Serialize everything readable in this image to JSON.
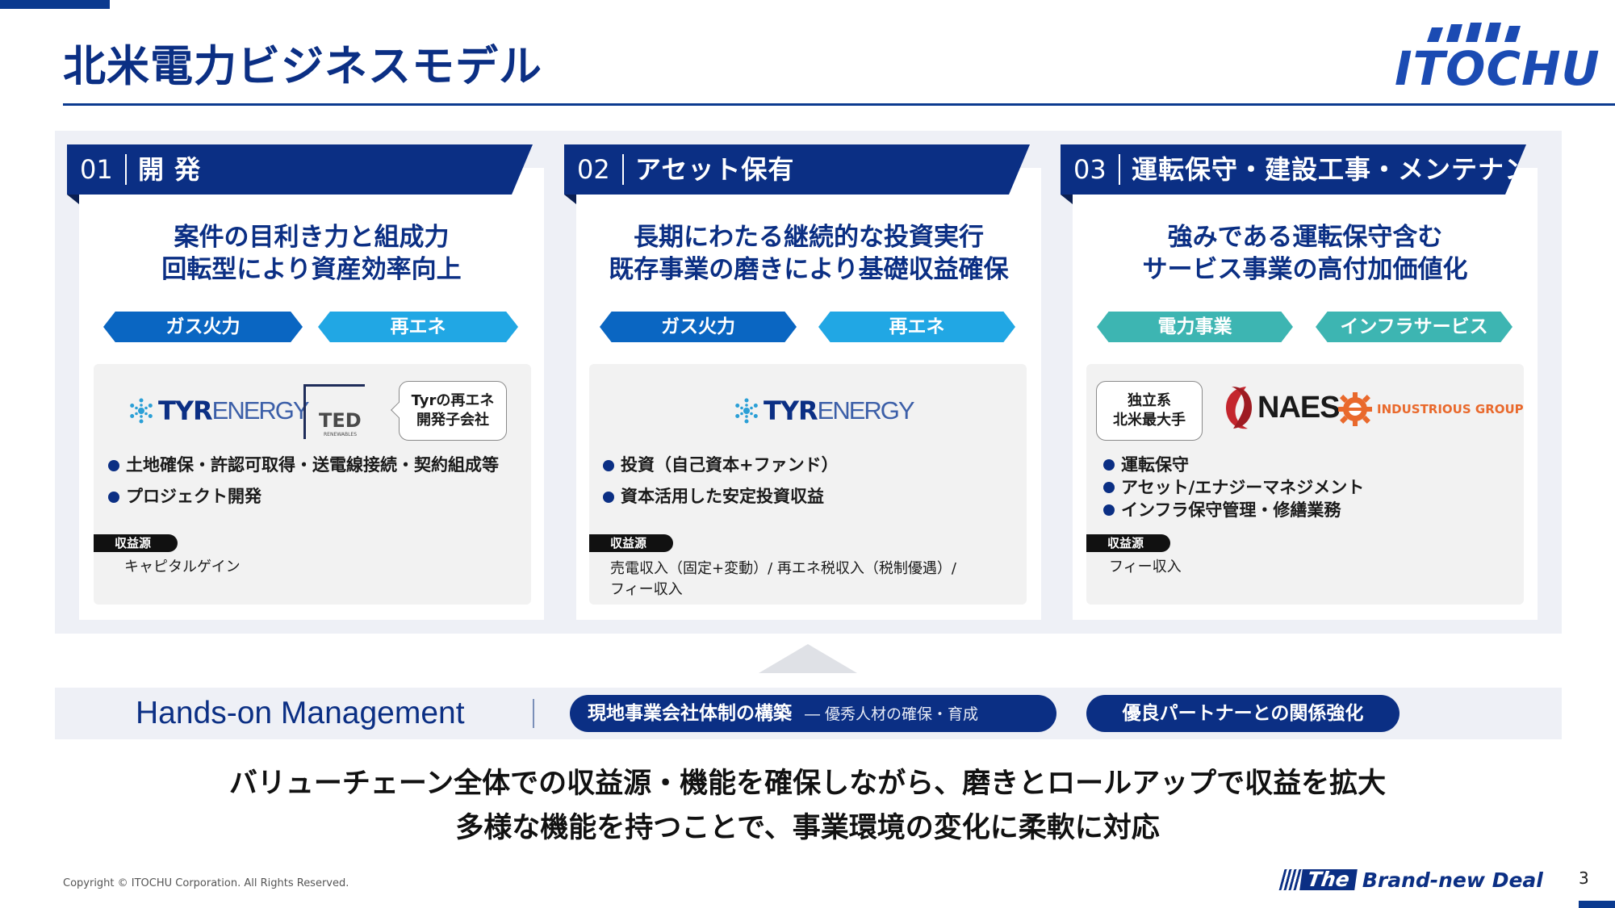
{
  "page_title": "北米電力ビジネスモデル",
  "logo": {
    "text": "ITOCHU"
  },
  "columns": [
    {
      "number": "01",
      "label": "開 発",
      "headline": [
        "案件の目利き力と組成力",
        "回転型により資産効率向上"
      ],
      "tags": [
        "ガス火力",
        "再エネ"
      ],
      "logos": {
        "tyr": {
          "bold": "TYR",
          "light": "ENERGY"
        },
        "ted": {
          "text": "TED",
          "sub": "RENEWABLES"
        }
      },
      "callout": [
        "Tyrの再エネ",
        "開発子会社"
      ],
      "bullets": [
        "土地確保・許認可取得・送電線接続・契約組成等",
        "プロジェクト開発"
      ],
      "revenue_label": "収益源",
      "revenue": [
        "キャピタルゲイン"
      ]
    },
    {
      "number": "02",
      "label": "アセット保有",
      "headline": [
        "長期にわたる継続的な投資実行",
        "既存事業の磨きにより基礎収益確保"
      ],
      "tags": [
        "ガス火力",
        "再エネ"
      ],
      "logos": {
        "tyr": {
          "bold": "TYR",
          "light": "ENERGY"
        }
      },
      "bullets": [
        "投資（自己資本+ファンド）",
        "資本活用した安定投資収益"
      ],
      "revenue_label": "収益源",
      "revenue": [
        "売電収入（固定+変動）/ 再エネ税収入（税制優遇）/",
        "フィー収入"
      ]
    },
    {
      "number": "03",
      "label": "運転保守・建設工事・メンテナンス",
      "headline": [
        "強みである運転保守含む",
        "サービス事業の高付加価値化"
      ],
      "tags": [
        "電力事業",
        "インフラサービス"
      ],
      "callout": [
        "独立系",
        "北米最大手"
      ],
      "logos": {
        "naes": "NAES",
        "industrious": "INDUSTRIOUS GROUP"
      },
      "bullets": [
        "運転保守",
        "アセット/エナジーマネジメント",
        "インフラ保守管理・修繕業務"
      ],
      "revenue_label": "収益源",
      "revenue": [
        "フィー収入"
      ]
    }
  ],
  "hands_on": {
    "title": "Hands-on Management",
    "pill1": {
      "main": "現地事業会社体制の構築",
      "sub": "― 優秀人材の確保・育成"
    },
    "pill2": "優良パートナーとの関係強化"
  },
  "summary": [
    "バリューチェーン全体での収益源・機能を確保しながら、磨きとロールアップで収益を拡大",
    "多様な機能を持つことで、事業環境の変化に柔軟に対応"
  ],
  "footer": {
    "copyright": "Copyright © ITOCHU Corporation. All Rights Reserved.",
    "brand_the": "The",
    "brand_deal": "Brand-new Deal",
    "page_number": "3"
  },
  "colors": {
    "navy": "#0b2f84",
    "tag_dark": "#0a66c2",
    "tag_light": "#21a7e4",
    "tag_teal": "#3db5b2",
    "panel": "#eef0f6"
  }
}
